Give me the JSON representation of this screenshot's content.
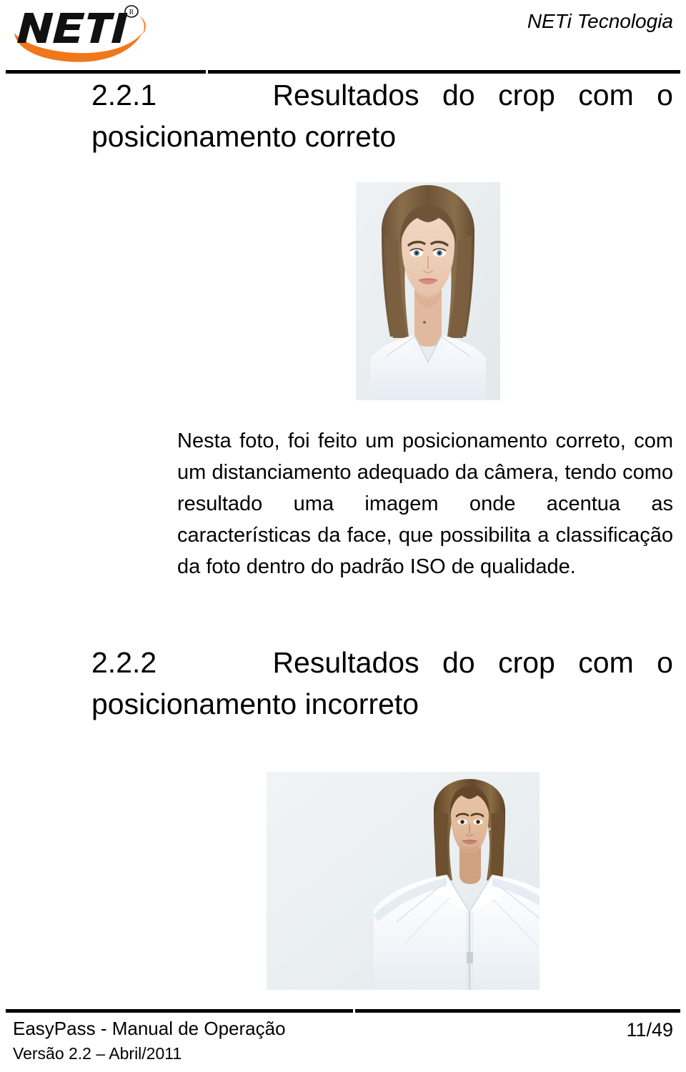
{
  "document": {
    "header": {
      "logo_text": "NETI",
      "logo_trademark": "®",
      "logo_accent_color": "#F0781B",
      "logo_text_color": "#000000",
      "company_name": "NETi Tecnologia"
    },
    "sections": [
      {
        "number": "2.2.1",
        "title": "Resultados do crop com o posicionamento correto",
        "figure": {
          "name": "cropped-portrait-correct",
          "caption": "",
          "alt": "Retrato recortado com posicionamento correto da face"
        },
        "paragraph": "Nesta foto, foi feito um posicionamento correto, com um distanciamento adequado da câmera, tendo como resultado uma imagem onde acentua as características da face, que possibilita a classificação da foto dentro do padrão ISO de qualidade."
      },
      {
        "number": "2.2.2",
        "title": "Resultados do crop com o posicionamento incorreto",
        "figure": {
          "name": "cropped-portrait-incorrect",
          "caption": "",
          "alt": "Retrato recortado com posicionamento incorreto, pessoa deslocada à direita"
        },
        "paragraph": ""
      }
    ],
    "footer": {
      "document_title": "EasyPass - Manual de Operação",
      "version": "Versão 2.2 – Abril/2011",
      "page_number": "11/49"
    }
  }
}
